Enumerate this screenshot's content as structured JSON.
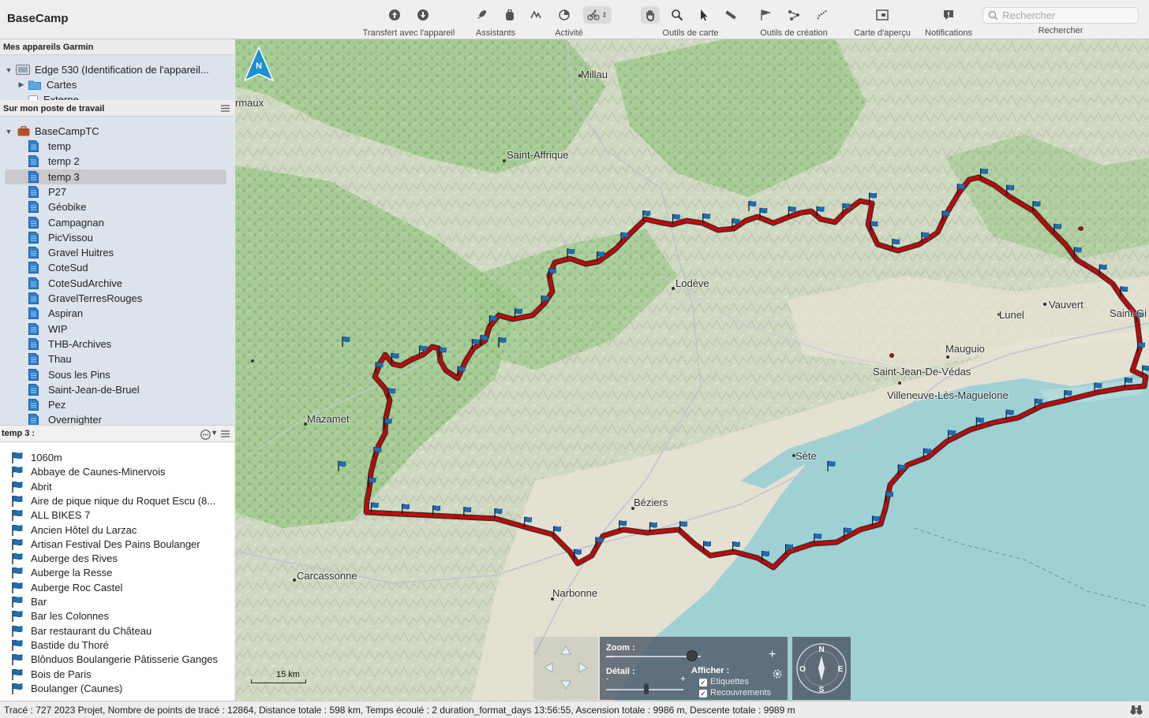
{
  "app": {
    "title": "BaseCamp"
  },
  "toolbar": {
    "groups": [
      {
        "label": "Transfert avec l'appareil",
        "icons": [
          "upload-icon",
          "download-icon"
        ]
      },
      {
        "label": "Assistants",
        "icons": [
          "rocket-icon",
          "backpack-icon"
        ]
      },
      {
        "label": "Activité",
        "icons": [
          "activity-icon",
          "activity-alt-icon",
          "cyclist-icon"
        ]
      },
      {
        "label": "Outils de carte",
        "icons": [
          "hand-icon",
          "zoom-icon",
          "pointer-icon",
          "ruler-icon"
        ]
      },
      {
        "label": "Outils de création",
        "icons": [
          "flag-tool-icon",
          "route-tool-icon",
          "track-tool-icon"
        ]
      },
      {
        "label": "Carte d'aperçu",
        "icons": [
          "overview-map-icon"
        ]
      },
      {
        "label": "Notifications",
        "icons": [
          "notification-icon"
        ]
      }
    ],
    "search": {
      "placeholder": "Rechercher",
      "label": "Rechercher"
    }
  },
  "sidebar": {
    "devices_header": "Mes appareils Garmin",
    "devices": [
      {
        "label": "Edge 530 (Identification de l'appareil...",
        "expanded": true,
        "icon": "device-icon"
      },
      {
        "label": "Cartes",
        "expanded": false,
        "icon": "folder-icon"
      },
      {
        "label": "Externe",
        "icon": "device-icon"
      }
    ],
    "workstation_header": "Sur mon poste de travail",
    "library": {
      "label": "BaseCampTC",
      "icon": "briefcase-icon"
    },
    "lists": [
      "temp",
      "temp 2",
      "temp 3",
      "P27",
      "Géobike",
      "Campagnan",
      "PicVissou",
      "Gravel Huitres",
      "CoteSud",
      "CoteSudArchive",
      "GravelTerresRouges",
      "Aspiran",
      "WIP",
      "THB-Archives",
      "Thau",
      "Sous les Pins",
      "Saint-Jean-de-Bruel",
      "Pez",
      "Overnighter"
    ],
    "selected_list": "temp 3",
    "items_header": "temp 3 :",
    "items": [
      "1060m",
      "Abbaye de Caunes-Minervois",
      "Abrit",
      "Aire de pique nique du Roquet Escu (8...",
      "ALL BIKES 7",
      "Ancien Hôtel du Larzac",
      "Artisan Festival Des Pains Boulanger",
      "Auberge des Rives",
      "Auberge la Resse",
      "Auberge Roc Castel",
      "Bar",
      "Bar les Colonnes",
      "Bar restaurant du Château",
      "Bastide du Thoré",
      "Blônduos Boulangerie Pâtisserie Ganges",
      "Bois de Paris",
      "Boulanger (Caunes)"
    ]
  },
  "map": {
    "places": [
      "Millau",
      "rmaux",
      "Saint-Affrique",
      "Lodève",
      "Vauvert",
      "Saint-Gi",
      "Lunel",
      "Mauguio",
      "Saint-Jean-De-Védas",
      "Villeneuve-Lès-Maguelone",
      "Mazamet",
      "Sète",
      "Béziers",
      "Carcassonne",
      "Narbonne"
    ],
    "north_label": "N",
    "scale_label": "15 km",
    "zoom_label": "Zoom :",
    "detail_label": "Détail :",
    "show_label": "Afficher :",
    "labels_option": "Etiquettes",
    "overlaps_option": "Recouvrements",
    "labels_checked": true,
    "overlaps_checked": true,
    "compass": {
      "n": "N",
      "s": "S",
      "e": "E",
      "w": "O"
    },
    "colors": {
      "track": "#d10000",
      "water": "#9fd0d4",
      "flag": "#1c6fb5"
    }
  },
  "status": "Tracé : 727 2023 Projet, Nombre de points de tracé : 12864, Distance totale : 598 km, Temps écoulé : 2 duration_format_days 13:56:55, Ascension totale : 9986 m, Descente totale : 9989 m"
}
